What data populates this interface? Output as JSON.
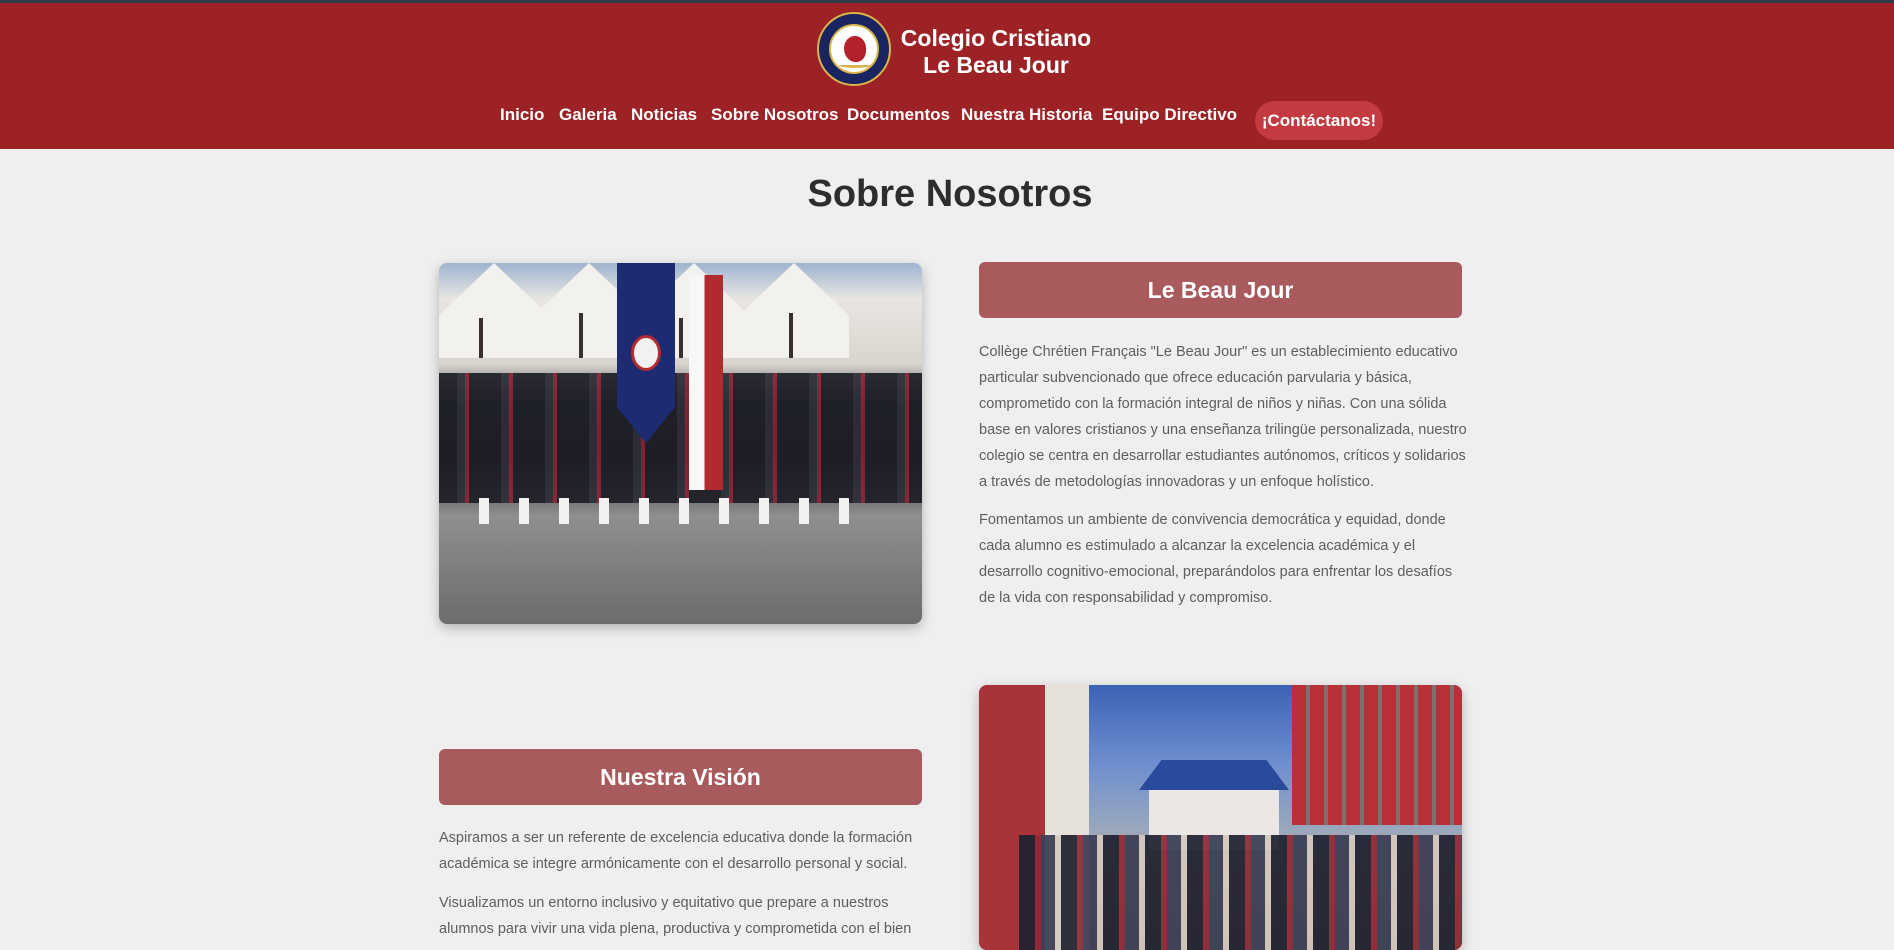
{
  "header": {
    "brand_line1": "Colegio Cristiano",
    "brand_line2": "Le Beau Jour",
    "logo_icon": "school-crest-icon",
    "accent_color": "#9c2226"
  },
  "nav": {
    "items": [
      {
        "label": "Inicio"
      },
      {
        "label": "Galeria"
      },
      {
        "label": "Noticias"
      },
      {
        "label": "Sobre Nosotros"
      },
      {
        "label": "Documentos"
      },
      {
        "label": "Nuestra Historia"
      },
      {
        "label": "Equipo Directivo"
      }
    ],
    "cta_label": "¡Contáctanos!"
  },
  "main": {
    "title": "Sobre Nosotros",
    "section1": {
      "title": "Le Beau Jour",
      "paragraph1": "Collège Chrétien Français \"Le Beau Jour\" es un establecimiento educativo particular subvencionado que ofrece educación parvularia y básica, comprometido con la formación integral de niños y niñas. Con una sólida base en valores cristianos y una enseñanza trilingüe personalizada, nuestro colegio se centra en desarrollar estudiantes autónomos, críticos y solidarios a través de metodologías innovadoras y un enfoque holístico.",
      "paragraph2": "Fomentamos un ambiente de convivencia democrática y equidad, donde cada alumno es estimulado a alcanzar la excelencia académica y el desarrollo cognitivo-emocional, preparándolos para enfrentar los desafíos de la vida con responsabilidad y compromiso."
    },
    "section2": {
      "title": "Nuestra Visión",
      "paragraph1": "Aspiramos a ser un referente de excelencia educativa donde la formación académica se integre armónicamente con el desarrollo personal y social.",
      "paragraph2": "Visualizamos un entorno inclusivo y equitativo que prepare a nuestros alumnos para vivir una vida plena, productiva y comprometida con el bien"
    },
    "title_box_color": "#a95a5d"
  }
}
